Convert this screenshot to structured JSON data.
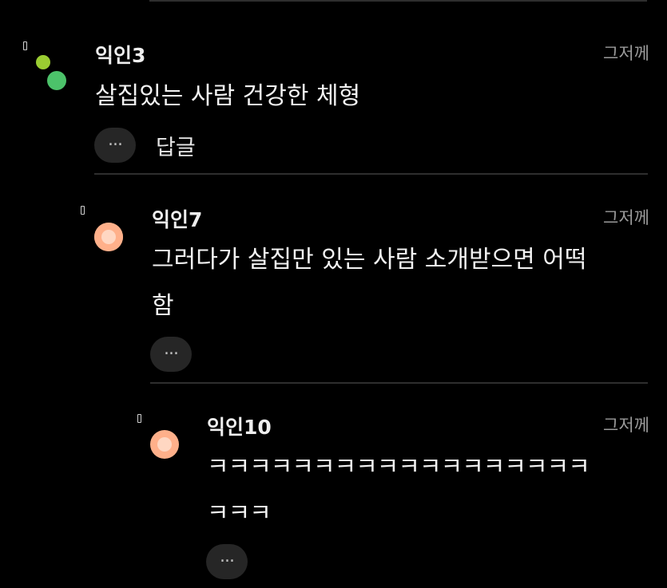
{
  "colors": {
    "background": "#000000",
    "divider": "#2e2e2e",
    "author_text": "#eeeeee",
    "body_text": "#f2f2f2",
    "time_text": "#9b9b9b",
    "more_button_bg": "#262626",
    "avatar_green_small": "#9acd32",
    "avatar_green_large": "#4cc26a",
    "avatar_orange": "#ffb08a"
  },
  "comments": [
    {
      "author": "익인3",
      "time": "그저께",
      "text_lines": [
        "살집있는 사람 건강한 체형"
      ],
      "more_icon": "ellipsis-icon",
      "reply_label": "답글"
    },
    {
      "author": "익인7",
      "time": "그저께",
      "text_lines": [
        "그러다가 살집만 있는 사람 소개받으면 어떡",
        "함"
      ],
      "more_icon": "ellipsis-icon"
    },
    {
      "author": "익인10",
      "time": "그저께",
      "text_lines": [
        "ㅋㅋㅋㅋㅋㅋㅋㅋㅋㅋㅋㅋㅋㅋㅋㅋㅋㅋ",
        "ㅋㅋㅋ"
      ],
      "more_icon": "ellipsis-icon"
    }
  ]
}
